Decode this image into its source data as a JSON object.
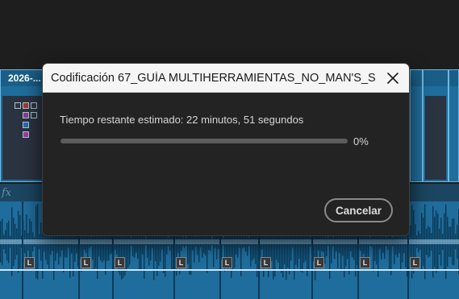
{
  "timeline": {
    "clip_label": "2026-...",
    "fx_label": "fx",
    "audio_badge": "L"
  },
  "dialog": {
    "title": "Codificación 67_GUÍA MULTIHERRAMIENTAS_NO_MAN'S_S...",
    "close_icon": "close-icon",
    "status": "Tiempo restante estimado: 22 minutos, 51 segundos",
    "progress": 0,
    "progress_label": "0%",
    "progress_color": "#3fa0ff",
    "cancel_label": "Cancelar"
  }
}
